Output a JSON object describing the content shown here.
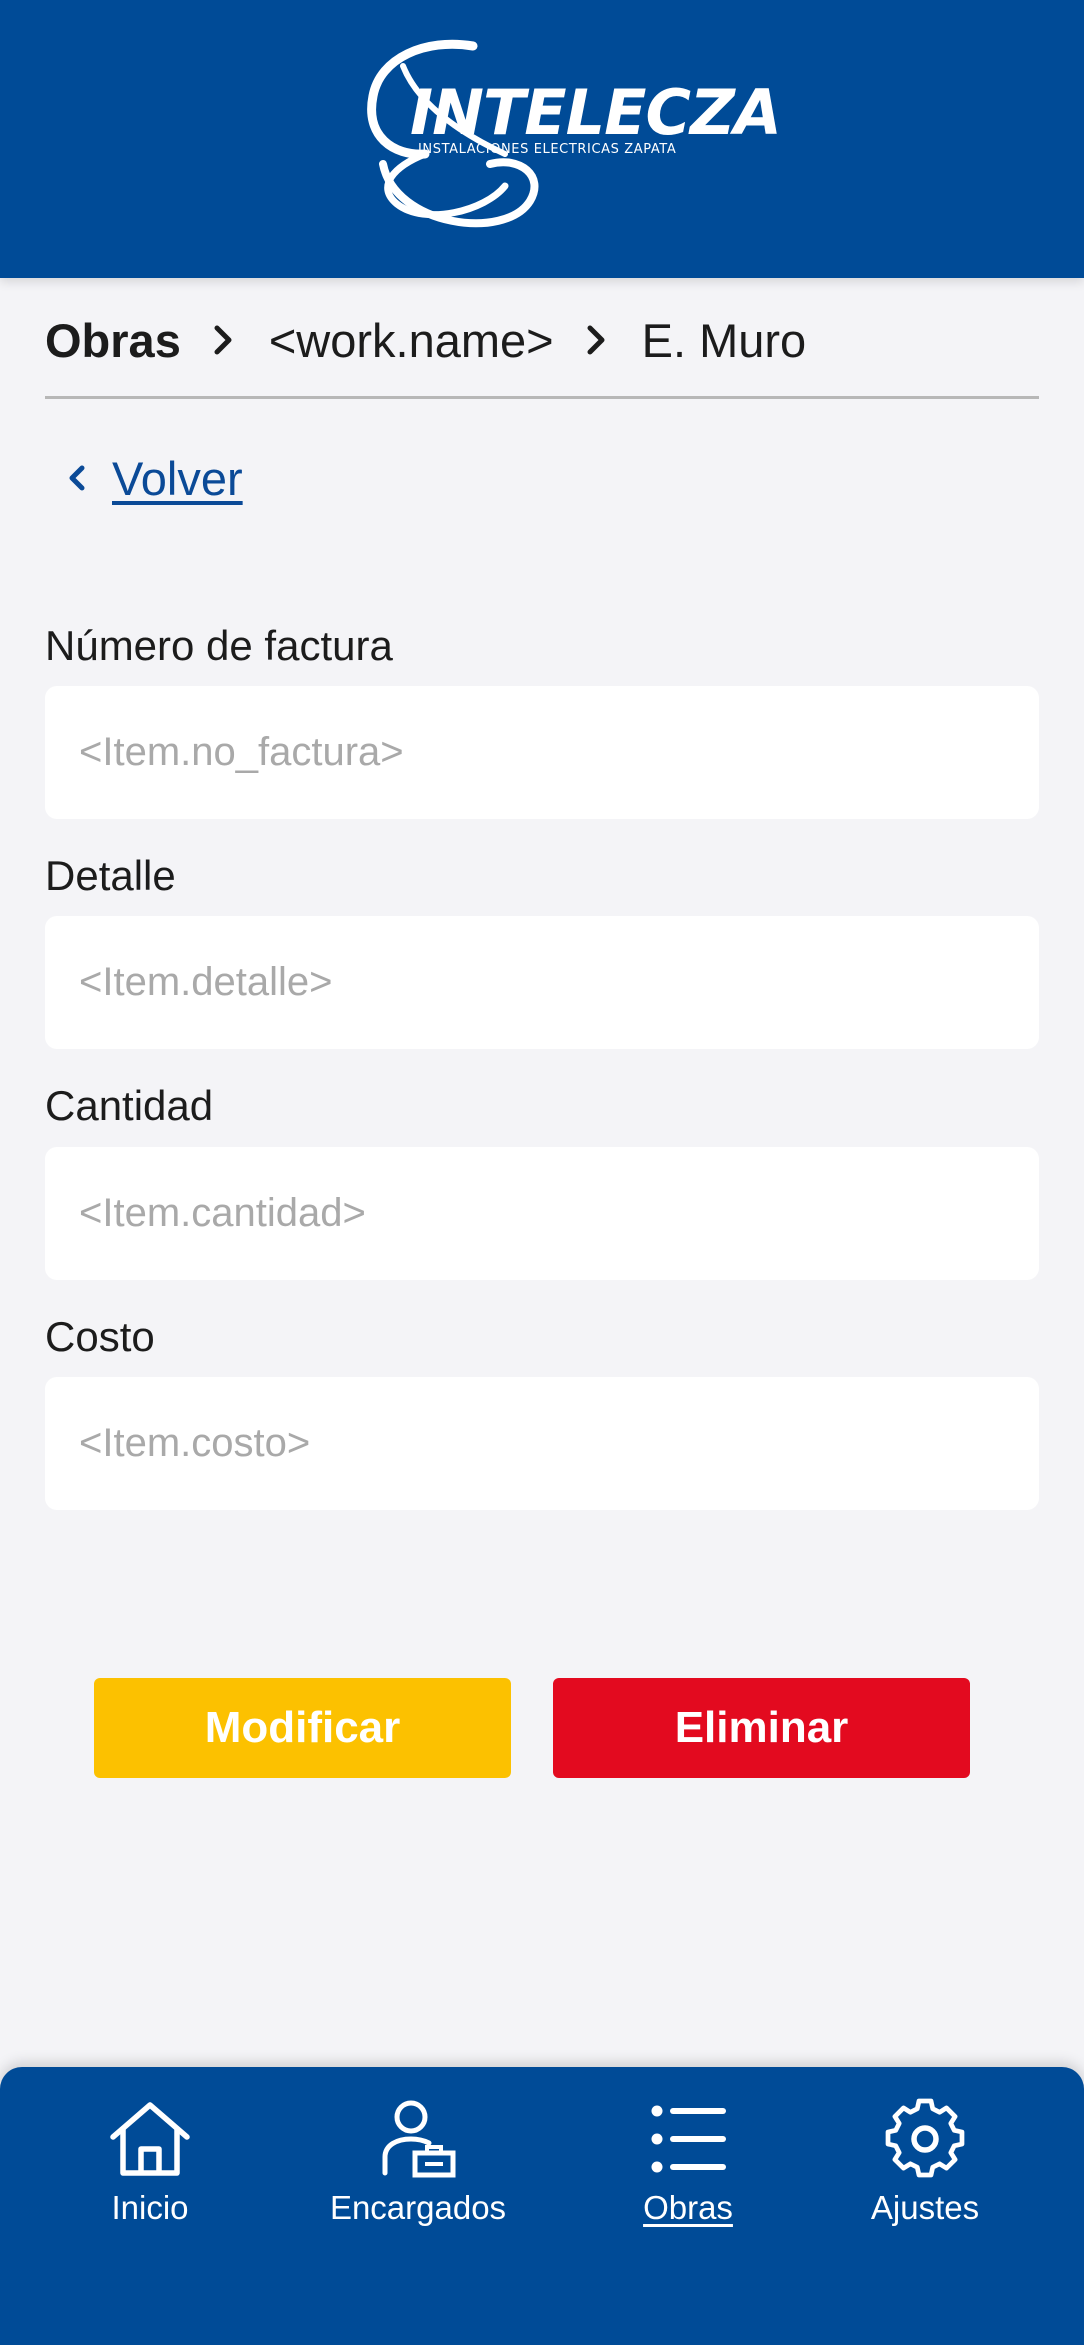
{
  "header": {
    "brand_name": "INTELECZA",
    "brand_tagline": "INSTALACIONES ELECTRICAS ZAPATA",
    "background_color": "#004b97"
  },
  "breadcrumb": {
    "items": [
      "Obras",
      "<work.name>",
      "E. Muro"
    ],
    "separator_icon": "chevron-right-icon"
  },
  "back_link": {
    "label": "Volver",
    "icon": "chevron-left-icon"
  },
  "form": {
    "invoice_number": {
      "label": "Número de factura",
      "placeholder": "<Item.no_factura>",
      "value": ""
    },
    "detail": {
      "label": "Detalle",
      "placeholder": "<Item.detalle>",
      "value": ""
    },
    "quantity": {
      "label": "Cantidad",
      "placeholder": "<Item.cantidad>",
      "value": ""
    },
    "cost": {
      "label": "Costo",
      "placeholder": "<Item.costo>",
      "value": ""
    }
  },
  "actions": {
    "modify_label": "Modificar",
    "delete_label": "Eliminar",
    "modify_color": "#fcc100",
    "delete_color": "#e30a1f"
  },
  "bottom_nav": {
    "items": [
      {
        "label": "Inicio",
        "icon": "home-icon",
        "active": false
      },
      {
        "label": "Encargados",
        "icon": "user-badge-icon",
        "active": false
      },
      {
        "label": "Obras",
        "icon": "list-icon",
        "active": true
      },
      {
        "label": "Ajustes",
        "icon": "gear-icon",
        "active": false
      }
    ]
  }
}
